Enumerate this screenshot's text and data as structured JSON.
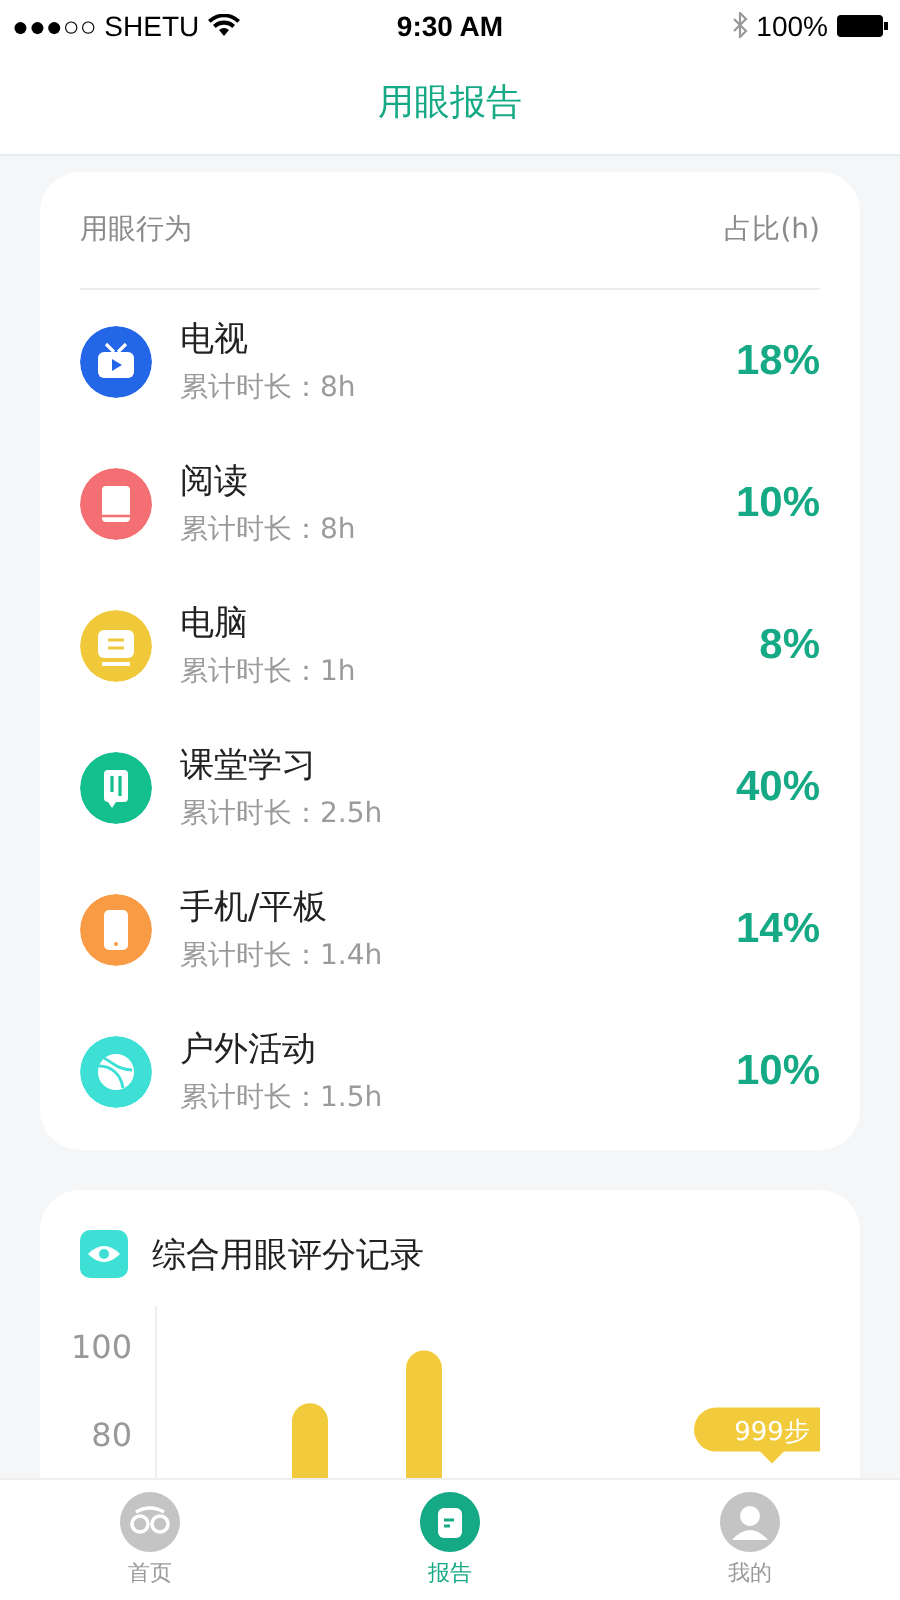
{
  "status_bar": {
    "carrier": "●●●○○ SHETU",
    "time": "9:30 AM",
    "battery": "100%"
  },
  "header": {
    "title": "用眼报告"
  },
  "usage": {
    "columns": [
      "用眼行为",
      "占比(h)"
    ],
    "rows": [
      {
        "kind": "tv",
        "name": "电视",
        "duration": "累计时长：8h",
        "share": "18%",
        "color": "#2466e8"
      },
      {
        "kind": "book",
        "name": "阅读",
        "duration": "累计时长：8h",
        "share": "10%",
        "color": "#f46f74"
      },
      {
        "kind": "computer",
        "name": "电脑",
        "duration": "累计时长：1h",
        "share": "8%",
        "color": "#f0c93a"
      },
      {
        "kind": "class",
        "name": "课堂学习",
        "duration": "累计时长：2.5h",
        "share": "40%",
        "color": "#14bf8e"
      },
      {
        "kind": "phone",
        "name": "手机/平板",
        "duration": "累计时长：1.4h",
        "share": "14%",
        "color": "#f99b45"
      },
      {
        "kind": "ball",
        "name": "户外活动",
        "duration": "累计时长：1.5h",
        "share": "10%",
        "color": "#3ee0d5"
      }
    ]
  },
  "score": {
    "title": "综合用眼评分记录",
    "axis_labels": [
      "100",
      "80"
    ],
    "tooltip": "999步"
  },
  "tab_bar": [
    {
      "kind": "home",
      "label": "首页",
      "selected": false
    },
    {
      "kind": "report",
      "label": "报告",
      "selected": true
    },
    {
      "kind": "me",
      "label": "我的",
      "selected": false
    }
  ]
}
